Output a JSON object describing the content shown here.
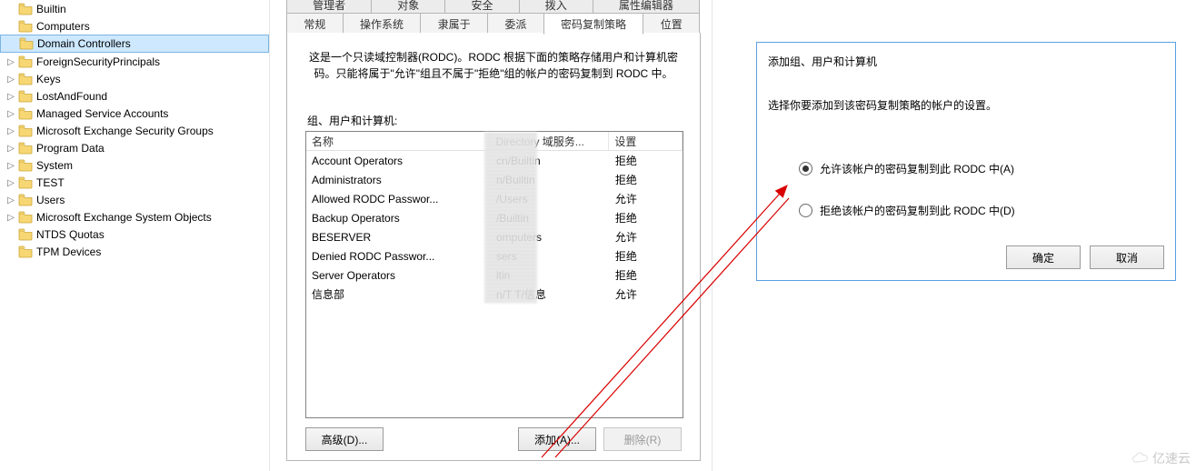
{
  "tree": {
    "items": [
      {
        "label": "Builtin",
        "indent": 0,
        "expander": " "
      },
      {
        "label": "Computers",
        "indent": 0,
        "expander": " "
      },
      {
        "label": "Domain Controllers",
        "indent": 0,
        "expander": " ",
        "selected": true
      },
      {
        "label": "ForeignSecurityPrincipals",
        "indent": 0,
        "expander": "▷"
      },
      {
        "label": "Keys",
        "indent": 0,
        "expander": "▷"
      },
      {
        "label": "LostAndFound",
        "indent": 0,
        "expander": "▷"
      },
      {
        "label": "Managed Service Accounts",
        "indent": 0,
        "expander": "▷"
      },
      {
        "label": "Microsoft Exchange Security Groups",
        "indent": 0,
        "expander": "▷"
      },
      {
        "label": "Program Data",
        "indent": 0,
        "expander": "▷"
      },
      {
        "label": "System",
        "indent": 0,
        "expander": "▷"
      },
      {
        "label": "TEST",
        "indent": 0,
        "expander": "▷"
      },
      {
        "label": "Users",
        "indent": 0,
        "expander": "▷"
      },
      {
        "label": "Microsoft Exchange System Objects",
        "indent": 0,
        "expander": "▷"
      },
      {
        "label": "NTDS Quotas",
        "indent": 0,
        "expander": " "
      },
      {
        "label": "TPM Devices",
        "indent": 0,
        "expander": " "
      }
    ]
  },
  "props": {
    "tabsRow1": [
      {
        "label": "管理者"
      },
      {
        "label": "对象"
      },
      {
        "label": "安全"
      },
      {
        "label": "拨入"
      },
      {
        "label": "属性编辑器"
      }
    ],
    "tabsRow2": [
      {
        "label": "常规"
      },
      {
        "label": "操作系统"
      },
      {
        "label": "隶属于"
      },
      {
        "label": "委派"
      },
      {
        "label": "密码复制策略",
        "active": true
      },
      {
        "label": "位置"
      }
    ],
    "description": "这是一个只读域控制器(RODC)。RODC 根据下面的策略存储用户和计算机密码。只能将属于\"允许\"组且不属于\"拒绝\"组的帐户的密码复制到 RODC 中。",
    "listLabel": "组、用户和计算机:",
    "columns": {
      "name": "名称",
      "dir": "Directory 域服务...",
      "set": "设置"
    },
    "rows": [
      {
        "name": "Account Operators",
        "dir": "cn/Builtin",
        "set": "拒绝"
      },
      {
        "name": "Administrators",
        "dir": "n/Builtin",
        "set": "拒绝"
      },
      {
        "name": "Allowed RODC Passwor...",
        "dir": "/Users",
        "set": "允许"
      },
      {
        "name": "Backup Operators",
        "dir": "/Builtin",
        "set": "拒绝"
      },
      {
        "name": "BESERVER",
        "dir": "omputers",
        "set": "允许"
      },
      {
        "name": "Denied RODC Passwor...",
        "dir": "sers",
        "set": "拒绝"
      },
      {
        "name": "Server Operators",
        "dir": "ltin",
        "set": "拒绝"
      },
      {
        "name": "信息部",
        "dir": "n/T   T/信息",
        "set": "允许"
      }
    ],
    "buttons": {
      "advanced": "高级(D)...",
      "add": "添加(A)...",
      "remove": "删除(R)"
    }
  },
  "dialog": {
    "title": "添加组、用户和计算机",
    "desc": "选择你要添加到该密码复制策略的帐户的设置。",
    "optAllow": "允许该帐户的密码复制到此 RODC 中(A)",
    "optDeny": "拒绝该帐户的密码复制到此 RODC 中(D)",
    "ok": "确定",
    "cancel": "取消"
  },
  "watermark": "亿速云"
}
